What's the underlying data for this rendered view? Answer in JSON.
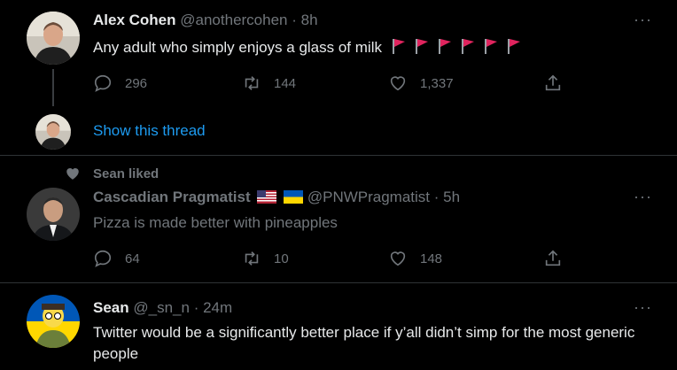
{
  "tweets": [
    {
      "name": "Alex Cohen",
      "handle": "@anothercohen",
      "sep": "·",
      "time": "8h",
      "text": "Any adult who simply enjoys a glass of milk",
      "flag_count": 6,
      "flag_color": "#e0245e",
      "replies": "296",
      "retweets": "144",
      "likes": "1,337",
      "show_thread": "Show this thread"
    },
    {
      "liked_by": "Sean liked",
      "name": "Cascadian Pragmatist",
      "handle": "@PNWPragmatist",
      "sep": "·",
      "time": "5h",
      "text": "Pizza is made better with pineapples",
      "replies": "64",
      "retweets": "10",
      "likes": "148"
    },
    {
      "name": "Sean",
      "handle": "@_sn_n",
      "sep": "·",
      "time": "24m",
      "text": "Twitter would be a significantly better place if y’all didn’t simp for the most generic people"
    }
  ],
  "more_label": "···",
  "colors": {
    "background": "#000000",
    "divider": "#2f3336",
    "muted": "#71767b",
    "link": "#1d9bf0"
  },
  "icons": [
    "reply-icon",
    "retweet-icon",
    "like-icon",
    "share-icon",
    "more-icon",
    "heart-icon",
    "flag-icon",
    "us-flag-icon",
    "ukraine-flag-icon"
  ]
}
